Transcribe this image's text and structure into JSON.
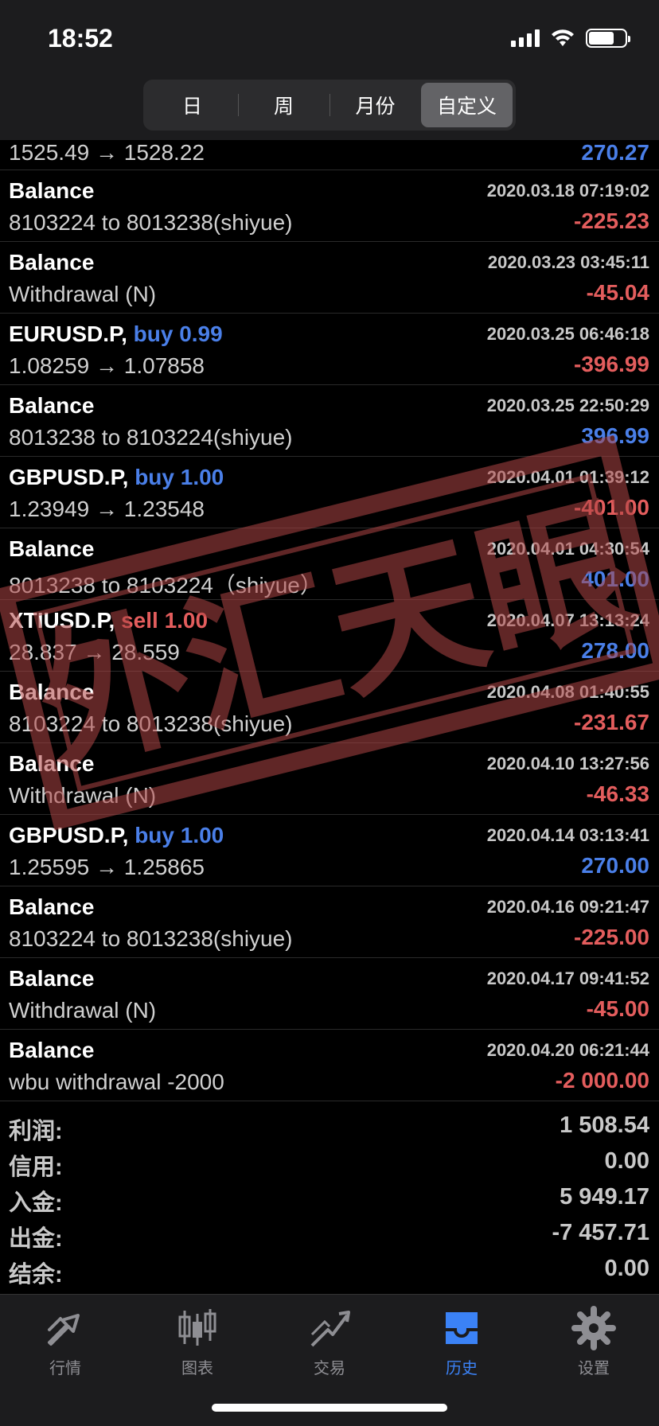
{
  "status": {
    "time": "18:52"
  },
  "segments": [
    "日",
    "周",
    "月份",
    "自定义"
  ],
  "first_row": {
    "line2": "1525.49 → 1528.22",
    "amount": "270.27",
    "amount_color": "pos"
  },
  "rows": [
    {
      "l1": "Balance",
      "side": "",
      "dt": "2020.03.18 07:19:02",
      "l2": "8103224 to 8013238(shiyue)",
      "amount": "-225.23",
      "sign": "neg"
    },
    {
      "l1": "Balance",
      "side": "",
      "dt": "2020.03.23 03:45:11",
      "l2": "Withdrawal (N)",
      "amount": "-45.04",
      "sign": "neg"
    },
    {
      "l1": "EURUSD.P,",
      "side": "buy 0.99",
      "dt": "2020.03.25 06:46:18",
      "l2": "1.08259 → 1.07858",
      "amount": "-396.99",
      "sign": "neg"
    },
    {
      "l1": "Balance",
      "side": "",
      "dt": "2020.03.25 22:50:29",
      "l2": "8013238 to 8103224(shiyue)",
      "amount": "396.99",
      "sign": "pos"
    },
    {
      "l1": "GBPUSD.P,",
      "side": "buy 1.00",
      "dt": "2020.04.01 01:39:12",
      "l2": "1.23949 → 1.23548",
      "amount": "-401.00",
      "sign": "neg"
    },
    {
      "l1": "Balance",
      "side": "",
      "dt": "2020.04.01 04:30:54",
      "l2": "8013238 to 8103224（shiyue）",
      "amount": "401.00",
      "sign": "pos"
    },
    {
      "l1": "XTIUSD.P,",
      "side": "sell 1.00",
      "dt": "2020.04.07 13:13:24",
      "l2": "28.837 → 28.559",
      "amount": "278.00",
      "sign": "pos"
    },
    {
      "l1": "Balance",
      "side": "",
      "dt": "2020.04.08 01:40:55",
      "l2": "8103224 to 8013238(shiyue)",
      "amount": "-231.67",
      "sign": "neg"
    },
    {
      "l1": "Balance",
      "side": "",
      "dt": "2020.04.10 13:27:56",
      "l2": "Withdrawal (N)",
      "amount": "-46.33",
      "sign": "neg"
    },
    {
      "l1": "GBPUSD.P,",
      "side": "buy 1.00",
      "dt": "2020.04.14 03:13:41",
      "l2": "1.25595 → 1.25865",
      "amount": "270.00",
      "sign": "pos"
    },
    {
      "l1": "Balance",
      "side": "",
      "dt": "2020.04.16 09:21:47",
      "l2": "8103224 to 8013238(shiyue)",
      "amount": "-225.00",
      "sign": "neg"
    },
    {
      "l1": "Balance",
      "side": "",
      "dt": "2020.04.17 09:41:52",
      "l2": "Withdrawal (N)",
      "amount": "-45.00",
      "sign": "neg"
    },
    {
      "l1": "Balance",
      "side": "",
      "dt": "2020.04.20 06:21:44",
      "l2": "wbu withdrawal -2000",
      "amount": "-2 000.00",
      "sign": "neg"
    }
  ],
  "summary": [
    {
      "k": "利润:",
      "v": "1 508.54"
    },
    {
      "k": "信用:",
      "v": "0.00"
    },
    {
      "k": "入金:",
      "v": "5 949.17"
    },
    {
      "k": "出金:",
      "v": "-7 457.71"
    },
    {
      "k": "结余:",
      "v": "0.00"
    }
  ],
  "stamp_text": "外汇天眼",
  "tabs": [
    {
      "label": "行情",
      "icon": "quotes-icon"
    },
    {
      "label": "图表",
      "icon": "candlestick-chart-icon"
    },
    {
      "label": "交易",
      "icon": "trade-icon"
    },
    {
      "label": "历史",
      "icon": "history-tray-icon"
    },
    {
      "label": "设置",
      "icon": "gear-icon"
    }
  ],
  "colors": {
    "positive": "#4a7fe8",
    "negative": "#e35d5d",
    "active_tab": "#3b82f6",
    "stamp": "#b04545"
  }
}
